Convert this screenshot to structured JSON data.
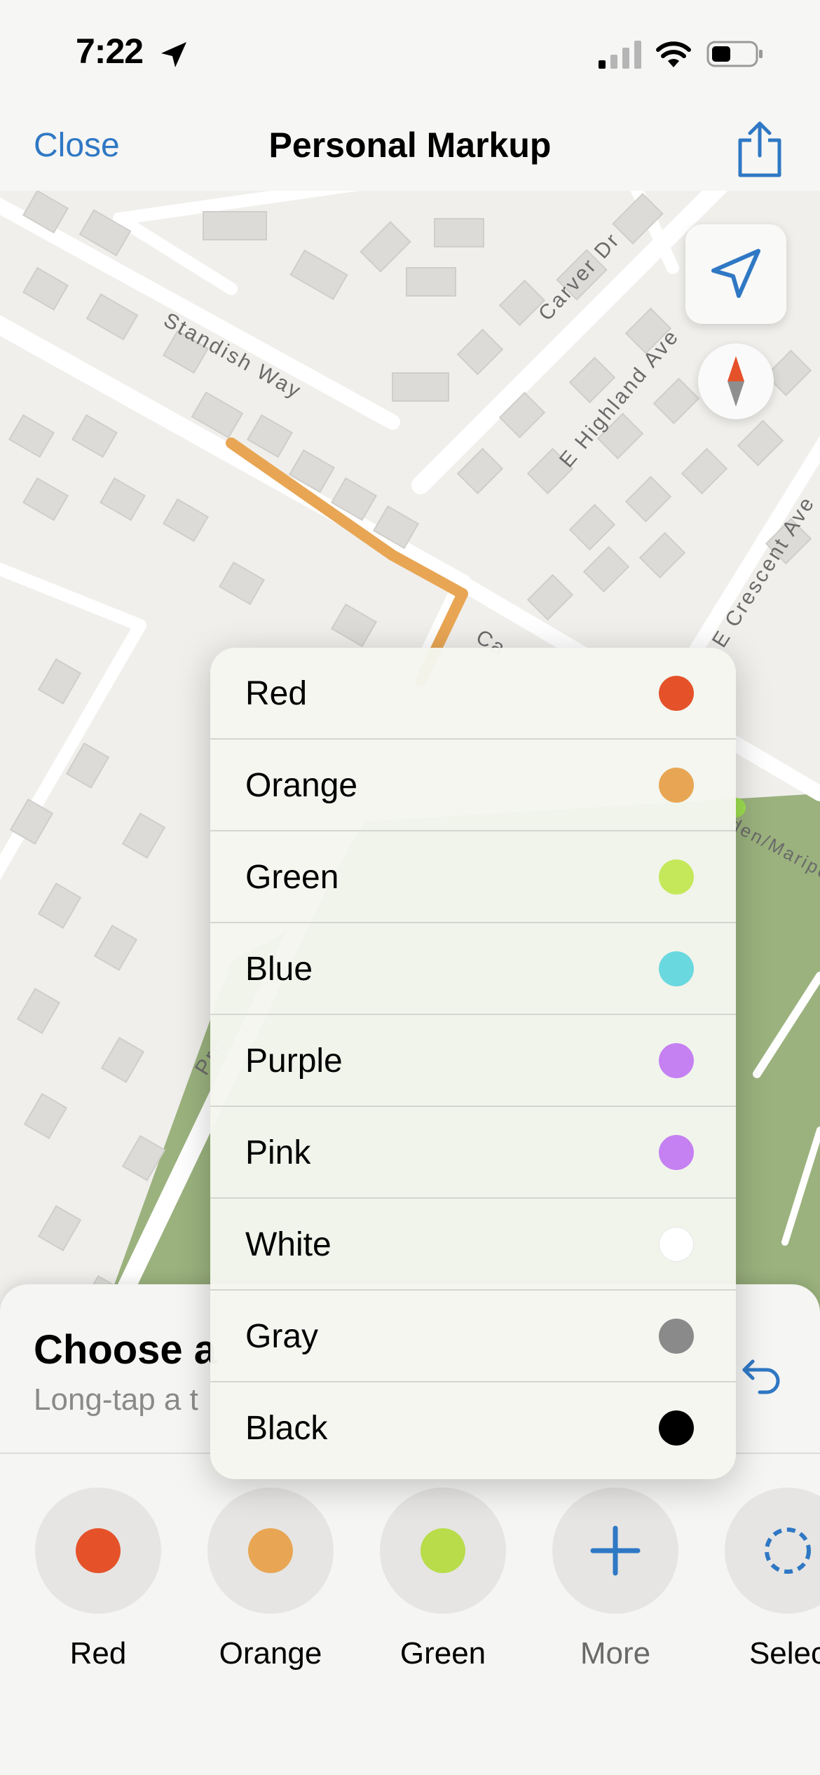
{
  "status_bar": {
    "time": "7:22"
  },
  "nav": {
    "close_label": "Close",
    "title": "Personal Markup",
    "share_icon": "share-icon"
  },
  "map": {
    "street_labels": [
      "Standish Way",
      "Carver Dr",
      "E Highland Ave",
      "E Crescent Ave",
      "Ca",
      "Pro",
      "den/Maripo"
    ]
  },
  "color_menu": {
    "items": [
      {
        "label": "Red",
        "color": "#e5522a"
      },
      {
        "label": "Orange",
        "color": "#e8a654"
      },
      {
        "label": "Green",
        "color": "#c4e85a"
      },
      {
        "label": "Blue",
        "color": "#6ad8df"
      },
      {
        "label": "Purple",
        "color": "#c580f2"
      },
      {
        "label": "Pink",
        "color": "#c580f2"
      },
      {
        "label": "White",
        "color": "#ffffff"
      },
      {
        "label": "Gray",
        "color": "#8a8a8a"
      },
      {
        "label": "Black",
        "color": "#000000"
      }
    ]
  },
  "sheet": {
    "title": "Choose a",
    "subtitle": "Long-tap a t",
    "undo_icon": "undo-icon",
    "tools": [
      {
        "label": "Red",
        "color": "#e5522a"
      },
      {
        "label": "Orange",
        "color": "#e8a654"
      },
      {
        "label": "Green",
        "color": "#b8dc4a"
      },
      {
        "label": "More",
        "icon": "plus-icon"
      },
      {
        "label": "Selec",
        "icon": "dashed-circle-icon"
      }
    ]
  }
}
